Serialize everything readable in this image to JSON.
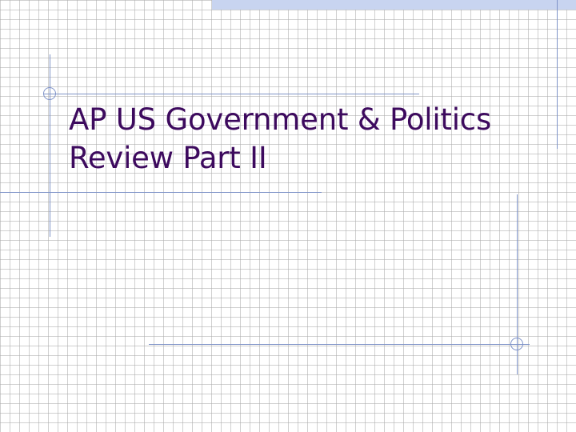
{
  "slide": {
    "title_line1": "AP US Government & Politics",
    "title_line2": "Review Part II",
    "colors": {
      "title": "#3d0a5e",
      "rule": "#7f93c8",
      "grid": "#aaaaaa",
      "top_band": "#c8d4f0",
      "background": "#ffffff"
    },
    "decor_icons": [
      "ring-icon",
      "ring-icon"
    ]
  }
}
